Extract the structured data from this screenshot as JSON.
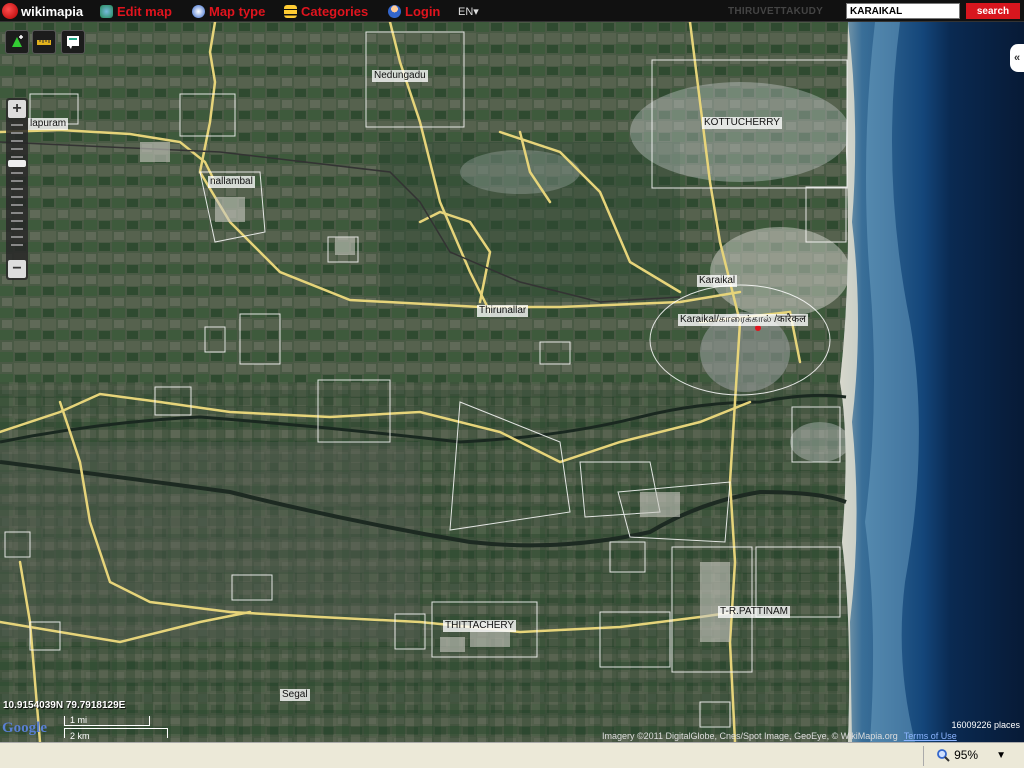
{
  "header": {
    "logo_text": "wikimapia",
    "nav": [
      {
        "label": "Edit map",
        "icon": "globe-edit-icon"
      },
      {
        "label": "Map type",
        "icon": "compass-icon"
      },
      {
        "label": "Categories",
        "icon": "categories-icon"
      },
      {
        "label": "Login",
        "icon": "user-icon"
      }
    ],
    "language": "EN",
    "current_place": "THIRUVETTAKUDY",
    "search": {
      "value": "KARAIKAL",
      "button_label": "search"
    }
  },
  "tools": [
    {
      "icon": "add-place-icon"
    },
    {
      "icon": "ruler-icon"
    },
    {
      "icon": "chat-icon"
    }
  ],
  "zoom": {
    "plus": "+",
    "minus": "−"
  },
  "collapse_label": "«",
  "map_labels": [
    {
      "id": "nedungadu",
      "text": "Nedungadu"
    },
    {
      "id": "kottucherry",
      "text": "KOTTUCHERRY"
    },
    {
      "id": "lapuram",
      "text": "lapuram"
    },
    {
      "id": "nallambal",
      "text": "nallambal"
    },
    {
      "id": "karaikal",
      "text": "Karaikal"
    },
    {
      "id": "karaikal-multi",
      "text": "Karaikal/காரைக்கால் /कारैकल"
    },
    {
      "id": "thirunallar",
      "text": "Thirunallar"
    },
    {
      "id": "trpattinam",
      "text": "T-R.PATTINAM"
    },
    {
      "id": "thittachery",
      "text": "THITTACHERY"
    },
    {
      "id": "segal",
      "text": "Segal"
    }
  ],
  "coordinates": "10.9154039N 79.7918129E",
  "google_logo": "Google",
  "scale": {
    "top": "1 mi",
    "bottom": "2 km"
  },
  "places_count": "16009226 places",
  "attribution": "Imagery ©2011 DigitalGlobe, Cnes/Spot Image, GeoEye, © WikiMapia.org",
  "terms_label": "Terms of Use",
  "status": {
    "zoom": "95%"
  },
  "colors": {
    "road": "#e8d97a",
    "outline": "#ffffff",
    "brand": "#e0141e",
    "sea": "#0a2a5a"
  }
}
